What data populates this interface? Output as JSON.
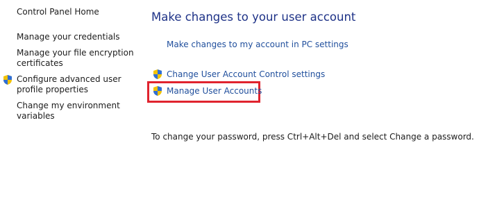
{
  "sidebar": {
    "home": "Control Panel Home",
    "credentials": "Manage your credentials",
    "encryption_line1": "Manage your file encryption",
    "encryption_line2": "certificates",
    "profile_line1": "Configure advanced user",
    "profile_line2": "profile properties",
    "environment_line1": "Change my environment",
    "environment_line2": "variables"
  },
  "main": {
    "title": "Make changes to your user account",
    "pc_settings_link": "Make changes to my account in PC settings",
    "uac_link": "Change User Account Control settings",
    "manage_accounts_link": "Manage User Accounts",
    "password_note": "To change your password, press Ctrl+Alt+Del and select Change a password."
  },
  "colors": {
    "link": "#1f4e9c",
    "title": "#1e3287",
    "highlight": "#e0232e"
  },
  "icons": {
    "uac_shield": "uac-shield-icon"
  }
}
